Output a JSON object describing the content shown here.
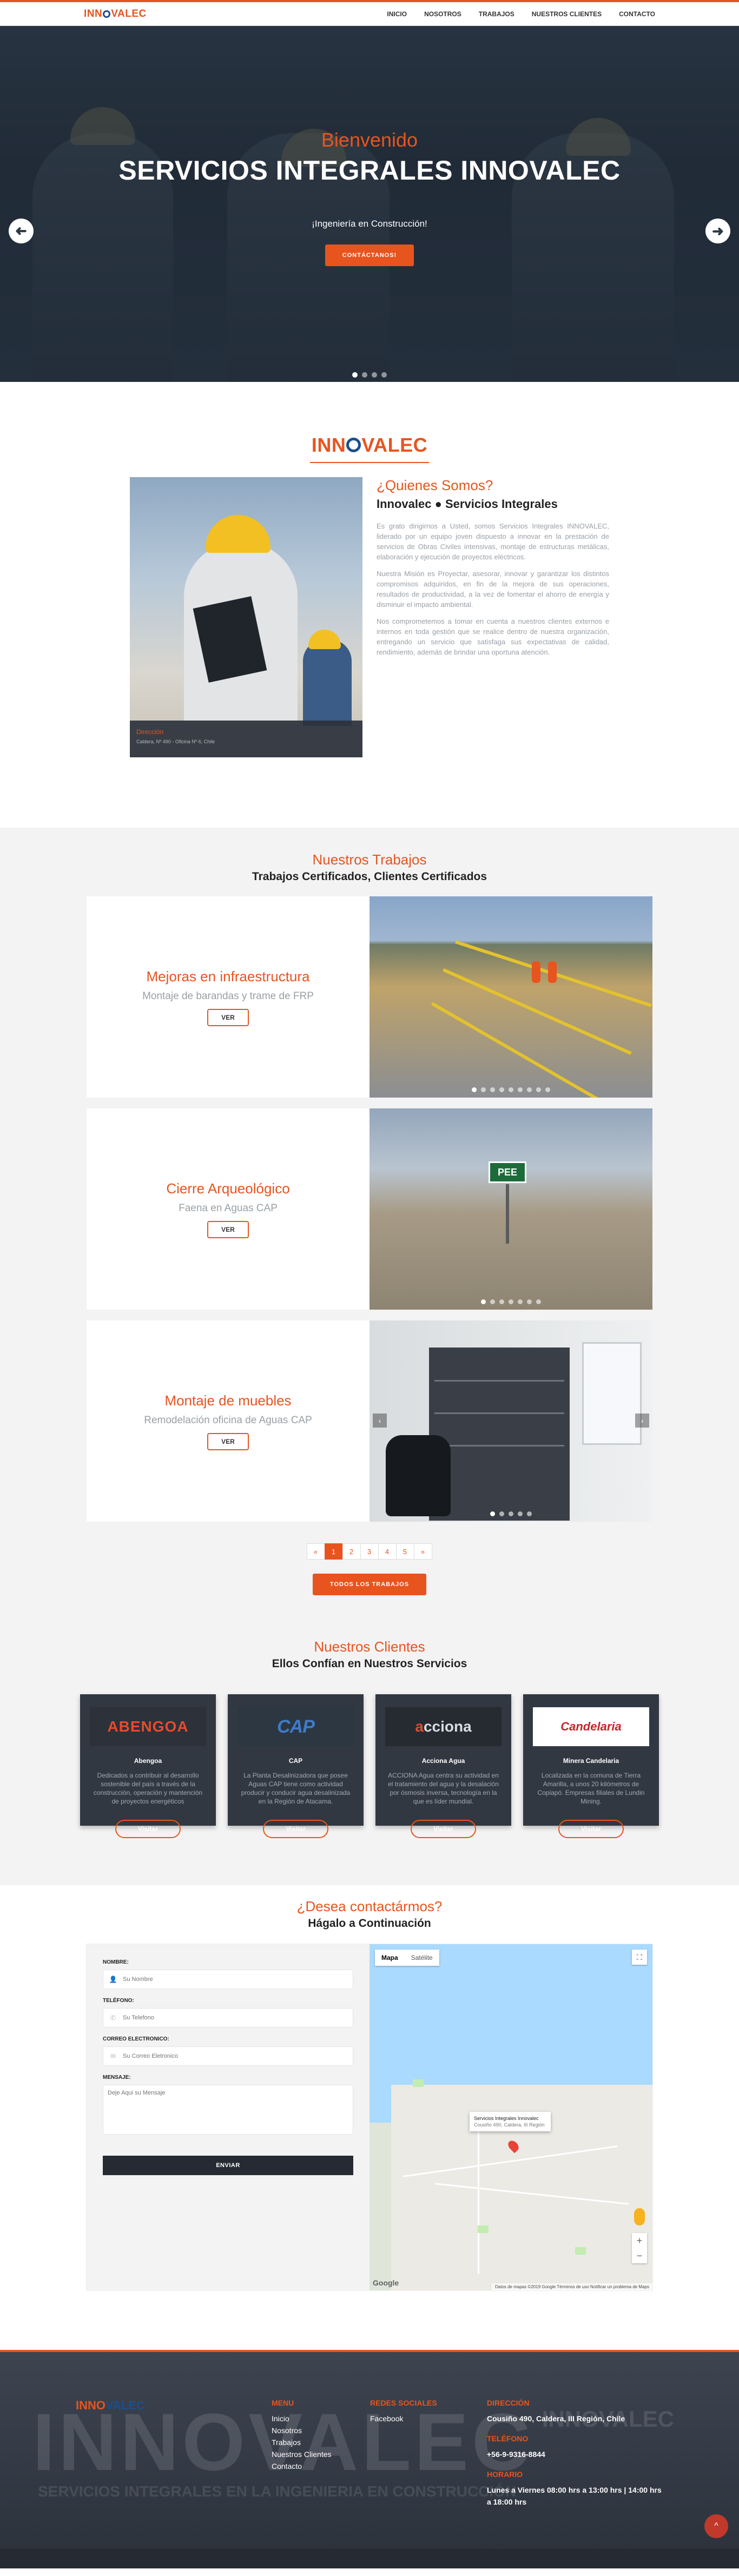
{
  "nav": {
    "logo_a": "INN",
    "logo_b": "VALEC",
    "links": [
      "INICIO",
      "NOSOTROS",
      "TRABAJOS",
      "NUESTROS CLIENTES",
      "CONTACTO"
    ]
  },
  "hero": {
    "kicker": "Bienvenido",
    "title": "SERVICIOS INTEGRALES INNOVALEC",
    "subtitle": "¡Ingeniería en Construcción!",
    "cta": "CONTÁCTANOS!",
    "arrow_prev": "➜",
    "arrow_next": "➜",
    "slides": 4,
    "active_slide": 1
  },
  "about": {
    "logo_a": "INN",
    "logo_b": "VALEC",
    "question": "¿Quienes Somos?",
    "heading": "Innovalec ● Servicios Integrales",
    "paragraphs": [
      "Es grato dirigirnos a Usted, somos Servicios Integrales INNOVALEC, liderado por un equipo joven dispuesto a innovar en la prestación de servicios de Obras Civiles intensivas, montaje de estructuras metálicas, elaboración y ejecución de proyectos eléctricos.",
      "Nuestra Misión es Proyectar, asesorar, innovar y garantizar los distintos compromisos adquiridos, en fin de la mejora de sus operaciones, resultados de productividad, a la vez de fomentar el ahorro de energía y disminuir el impacto ambiental.",
      "Nos comprometemos a tomar en cuenta a nuestros clientes externos e internos en toda gestión que se realice dentro de nuestra organización, entregando un servicio que satisfaga sus expectativas de calidad, rendimiento, además de brindar una oportuna atención."
    ],
    "caption_label": "Dirección",
    "caption_text": "Caldera, Nº 490 - Oficina Nº 6, Chile"
  },
  "works": {
    "kicker": "Nuestros Trabajos",
    "title": "Trabajos Certificados, Clientes Certificados",
    "items": [
      {
        "title": "Mejoras en infraestructura",
        "subtitle": "Montaje de barandas y trame de FRP",
        "button": "VER",
        "dots": 9,
        "active": 0
      },
      {
        "title": "Cierre Arqueológico",
        "subtitle": "Faena en Aguas CAP",
        "button": "VER",
        "dots": 7,
        "active": 0,
        "sign": "PEE"
      },
      {
        "title": "Montaje de muebles",
        "subtitle": "Remodelación oficina de Aguas CAP",
        "button": "VER",
        "dots": 5,
        "active": 0
      }
    ],
    "carousel_prev": "‹",
    "carousel_next": "›",
    "pager": [
      "«",
      "1",
      "2",
      "3",
      "4",
      "5",
      "»"
    ],
    "pager_active": 1,
    "all_button": "TODOS LOS TRABAJOS"
  },
  "clients": {
    "kicker": "Nuestros Clientes",
    "title": "Ellos Confían en Nuestros Servicios",
    "items": [
      {
        "logo": "ABENGOA",
        "name": "Abengoa",
        "desc": "Dedicados a contribuir al desarrollo sostenible del país a través de la construcción, operación y mantención de proyectos energéticos",
        "button": "Visitar"
      },
      {
        "logo": "CAP",
        "name": "CAP",
        "desc": "La Planta Desalinizadora que posee Aguas CAP tiene como actividad producir y conducir agua desalinizada en la Región de Atacama.",
        "button": "Visitar"
      },
      {
        "logo_a": "a",
        "logo_b": "cciona",
        "name": "Acciona Agua",
        "desc": "ACCIONA Agua centra su actividad en el tratamiento del agua y la desalación por ósmosis inversa, tecnología en la que es líder mundial.",
        "button": "Visitar"
      },
      {
        "logo": "Candelaria",
        "name": "Minera Candelaria",
        "desc": "Localizada en la comuna de Tierra Amarilla, a unos 20 kilómetros de Copiapó. Empresas filiales de Lundin Mining.",
        "button": "Visitar"
      }
    ]
  },
  "contact": {
    "kicker": "¿Desea contactármos?",
    "title": "Hágalo a Continuación",
    "fields": [
      {
        "label": "NOMBRE:",
        "placeholder": "Su Nombre",
        "icon": "👤"
      },
      {
        "label": "TELÉFONO:",
        "placeholder": "Su Telefono",
        "icon": "✆"
      },
      {
        "label": "CORREO ELECTRONICO:",
        "placeholder": "Su Correo Eletronico",
        "icon": "✉"
      }
    ],
    "message_label": "MENSAJE:",
    "message_placeholder": "Deje Aqui su Mensaje",
    "submit": "ENVIAR",
    "map": {
      "tab_map": "Mapa",
      "tab_sat": "Satélite",
      "fullscreen": "⛶",
      "zoom_in": "+",
      "zoom_out": "−",
      "info_title": "Servicios Integrales Innovalec",
      "info_sub": "Cousiño 490, Caldera, III Región",
      "brand": "Google",
      "attribution": "Datos de mapas ©2019 Google   Términos de uso   Notificar un problema de Maps"
    }
  },
  "footer": {
    "logo_a": "INNO",
    "logo_b": "VALEC",
    "bg_logo": "INNOVALEC",
    "bg_slogan": "SERVICIOS INTEGRALES EN LA INGENIERIA EN CONSTRUCCIÓN",
    "menu_title": "MENU",
    "menu": [
      "Inicio",
      "Nosotros",
      "Trabajos",
      "Nuestros Clientes",
      "Contacto"
    ],
    "social_title": "REDES SOCIALES",
    "social": [
      "Facebook"
    ],
    "address_title": "DIRECCIÓN",
    "address": "Cousiño 490, Caldera, III Región, Chile",
    "phone_title": "TELÉFONO",
    "phone": "+56-9-9316-8844",
    "hours_title": "HORARIO",
    "hours": "Lunes a Viernes 08:00 hrs a 13:00 hrs | 14:00 hrs a 18:00 hrs",
    "to_top": "^"
  },
  "colors": {
    "accent": "#e8541e",
    "brand_blue": "#1a4f8e",
    "dark": "#262b33"
  }
}
